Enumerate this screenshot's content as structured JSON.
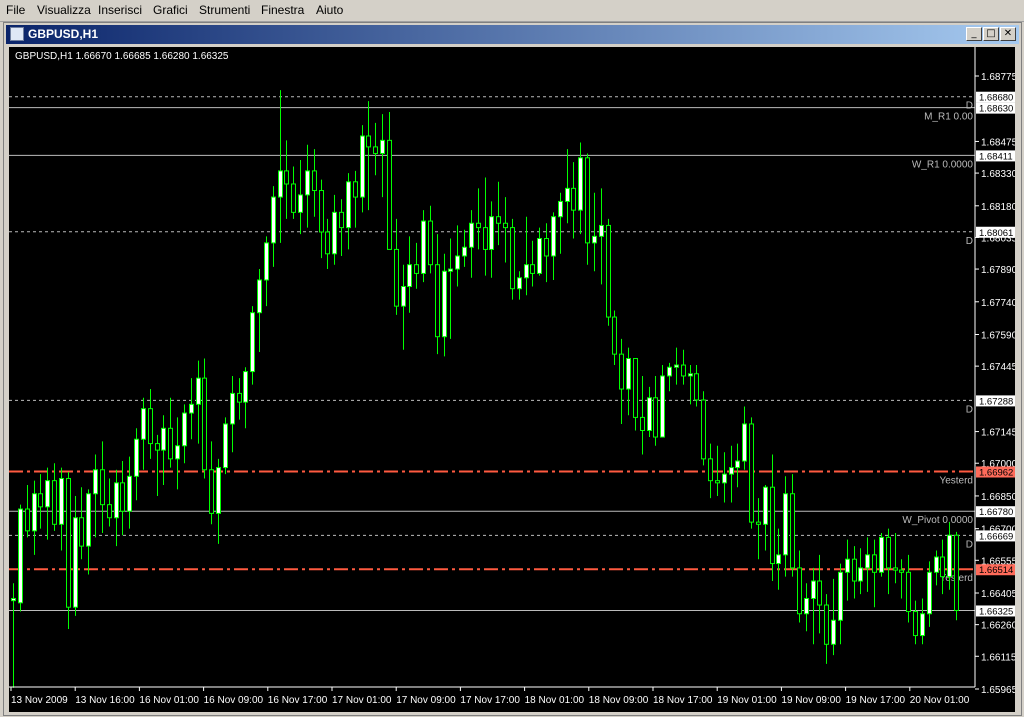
{
  "menu": [
    "File",
    "Visualizza",
    "Inserisci",
    "Grafici",
    "Strumenti",
    "Finestra",
    "Aiuto"
  ],
  "window": {
    "title": "GBPUSD,H1",
    "minimize_glyph": "_",
    "maximize_glyph": "□",
    "close_glyph": "✕"
  },
  "chart": {
    "info": "GBPUSD,H1  1.66670 1.66685 1.66280 1.66325",
    "symbol": "GBPUSD",
    "timeframe": "H1",
    "ohlc": {
      "open": 1.6667,
      "high": 1.66685,
      "low": 1.6628,
      "close": 1.66325
    },
    "colors": {
      "background": "#000000",
      "candle": "#00ff00",
      "bull_body": "#ffffff",
      "bear_body": "#000000",
      "level": "#bbbbbb",
      "yesterday": "#ff5a40"
    }
  },
  "chart_data": {
    "type": "candlestick",
    "title": "GBPUSD,H1",
    "price_ticks": [
      "1.68775",
      "1.68475",
      "1.68330",
      "1.68180",
      "1.68035",
      "1.67890",
      "1.67740",
      "1.67590",
      "1.67445",
      "1.67145",
      "1.67000",
      "1.66850",
      "1.66700",
      "1.66555",
      "1.66405",
      "1.66260",
      "1.66115",
      "1.65965"
    ],
    "ylim": [
      1.65965,
      1.68775
    ],
    "time_labels": [
      "13 Nov 2009",
      "13 Nov 16:00",
      "16 Nov 01:00",
      "16 Nov 09:00",
      "16 Nov 17:00",
      "17 Nov 01:00",
      "17 Nov 09:00",
      "17 Nov 17:00",
      "18 Nov 01:00",
      "18 Nov 09:00",
      "18 Nov 17:00",
      "19 Nov 01:00",
      "19 Nov 09:00",
      "19 Nov 17:00",
      "20 Nov 01:00"
    ],
    "levels": [
      {
        "price": 1.6868,
        "tag": "1.68680",
        "label": "D",
        "style": "dashed",
        "color": "#bbbbbb"
      },
      {
        "price": 1.6863,
        "tag": "1.68630",
        "label": "M_R1 0.00",
        "style": "solid",
        "color": "#bbbbbb"
      },
      {
        "price": 1.68411,
        "tag": "1.68411",
        "label": "W_R1 0.0000",
        "style": "solid",
        "color": "#bbbbbb"
      },
      {
        "price": 1.68061,
        "tag": "1.68061",
        "label": "D",
        "style": "dashed",
        "color": "#bbbbbb"
      },
      {
        "price": 1.67288,
        "tag": "1.67288",
        "label": "D",
        "style": "dashed",
        "color": "#bbbbbb"
      },
      {
        "price": 1.66962,
        "tag": "1.66962",
        "label": "Yesterd",
        "style": "dashdot",
        "color": "#ff5a40"
      },
      {
        "price": 1.6678,
        "tag": "1.66780",
        "label": "W_Pivot 0.0000",
        "style": "solid",
        "color": "#bbbbbb"
      },
      {
        "price": 1.66669,
        "tag": "1.66669",
        "label": "D",
        "style": "dashed",
        "color": "#bbbbbb"
      },
      {
        "price": 1.66514,
        "tag": "1.66514",
        "label": "Yesterd",
        "style": "dashdot",
        "color": "#ff5a40"
      },
      {
        "price": 1.66325,
        "tag": "1.66325",
        "label": "",
        "style": "solid",
        "color": "#bbbbbb"
      }
    ],
    "candles": [
      [
        1.6637,
        1.6645,
        1.6597,
        1.6638
      ],
      [
        1.6636,
        1.6681,
        1.6632,
        1.6679
      ],
      [
        1.6679,
        1.669,
        1.6666,
        1.6669
      ],
      [
        1.6669,
        1.6692,
        1.6658,
        1.6686
      ],
      [
        1.6686,
        1.6695,
        1.667,
        1.668
      ],
      [
        1.668,
        1.6698,
        1.6665,
        1.6692
      ],
      [
        1.6692,
        1.67,
        1.6669,
        1.6672
      ],
      [
        1.6672,
        1.6698,
        1.666,
        1.6693
      ],
      [
        1.6693,
        1.6696,
        1.6624,
        1.6634
      ],
      [
        1.6634,
        1.6685,
        1.663,
        1.6675
      ],
      [
        1.6675,
        1.6689,
        1.6656,
        1.6662
      ],
      [
        1.6662,
        1.6688,
        1.6649,
        1.6686
      ],
      [
        1.6686,
        1.6704,
        1.6666,
        1.6697
      ],
      [
        1.6697,
        1.671,
        1.6668,
        1.6681
      ],
      [
        1.6681,
        1.6693,
        1.6671,
        1.6675
      ],
      [
        1.6675,
        1.6697,
        1.6662,
        1.6691
      ],
      [
        1.6691,
        1.6701,
        1.6667,
        1.6678
      ],
      [
        1.6678,
        1.6703,
        1.667,
        1.6694
      ],
      [
        1.6694,
        1.6716,
        1.6683,
        1.6711
      ],
      [
        1.6711,
        1.673,
        1.6697,
        1.6725
      ],
      [
        1.6725,
        1.6734,
        1.6702,
        1.6709
      ],
      [
        1.6709,
        1.6713,
        1.6685,
        1.6706
      ],
      [
        1.6706,
        1.6722,
        1.669,
        1.6716
      ],
      [
        1.6716,
        1.673,
        1.6698,
        1.6702
      ],
      [
        1.6702,
        1.6721,
        1.6688,
        1.6708
      ],
      [
        1.6708,
        1.6727,
        1.67,
        1.6723
      ],
      [
        1.6723,
        1.6739,
        1.6711,
        1.6727
      ],
      [
        1.6727,
        1.6747,
        1.6709,
        1.6739
      ],
      [
        1.6739,
        1.6748,
        1.6693,
        1.6697
      ],
      [
        1.6697,
        1.671,
        1.6672,
        1.6677
      ],
      [
        1.6677,
        1.6702,
        1.6663,
        1.6698
      ],
      [
        1.6698,
        1.6721,
        1.6695,
        1.6718
      ],
      [
        1.6718,
        1.674,
        1.6705,
        1.6732
      ],
      [
        1.6732,
        1.6739,
        1.672,
        1.6728
      ],
      [
        1.6728,
        1.6744,
        1.6716,
        1.6742
      ],
      [
        1.6742,
        1.6772,
        1.6736,
        1.6769
      ],
      [
        1.6769,
        1.6789,
        1.6751,
        1.6784
      ],
      [
        1.6784,
        1.6804,
        1.6772,
        1.6801
      ],
      [
        1.6801,
        1.6827,
        1.679,
        1.6822
      ],
      [
        1.6822,
        1.6871,
        1.6801,
        1.6834
      ],
      [
        1.6834,
        1.6848,
        1.6812,
        1.6828
      ],
      [
        1.6828,
        1.6836,
        1.6812,
        1.6815
      ],
      [
        1.6815,
        1.6839,
        1.6805,
        1.6823
      ],
      [
        1.6823,
        1.6846,
        1.6808,
        1.6834
      ],
      [
        1.6834,
        1.6844,
        1.6813,
        1.6825
      ],
      [
        1.6825,
        1.683,
        1.6794,
        1.6806
      ],
      [
        1.6806,
        1.6812,
        1.6789,
        1.6796
      ],
      [
        1.6796,
        1.6823,
        1.6791,
        1.6815
      ],
      [
        1.6815,
        1.6821,
        1.6795,
        1.6808
      ],
      [
        1.6808,
        1.6833,
        1.6798,
        1.6829
      ],
      [
        1.6829,
        1.6834,
        1.6808,
        1.6822
      ],
      [
        1.6822,
        1.6855,
        1.6815,
        1.685
      ],
      [
        1.685,
        1.6866,
        1.6816,
        1.6845
      ],
      [
        1.6845,
        1.6856,
        1.6832,
        1.6842
      ],
      [
        1.6842,
        1.686,
        1.6822,
        1.6848
      ],
      [
        1.6848,
        1.6861,
        1.6799,
        1.6798
      ],
      [
        1.6798,
        1.6812,
        1.6768,
        1.6772
      ],
      [
        1.6772,
        1.6791,
        1.6752,
        1.6781
      ],
      [
        1.6781,
        1.6804,
        1.6769,
        1.6791
      ],
      [
        1.6791,
        1.6801,
        1.678,
        1.6787
      ],
      [
        1.6787,
        1.6816,
        1.6783,
        1.6811
      ],
      [
        1.6811,
        1.6818,
        1.6787,
        1.6791
      ],
      [
        1.6791,
        1.6805,
        1.675,
        1.6758
      ],
      [
        1.6758,
        1.6796,
        1.6749,
        1.6788
      ],
      [
        1.6788,
        1.6803,
        1.6757,
        1.6789
      ],
      [
        1.6789,
        1.6809,
        1.6781,
        1.6795
      ],
      [
        1.6795,
        1.6807,
        1.679,
        1.6799
      ],
      [
        1.6799,
        1.6816,
        1.6785,
        1.681
      ],
      [
        1.681,
        1.6826,
        1.6798,
        1.6808
      ],
      [
        1.6808,
        1.6831,
        1.6786,
        1.6798
      ],
      [
        1.6798,
        1.682,
        1.6785,
        1.6813
      ],
      [
        1.6813,
        1.6829,
        1.68,
        1.681
      ],
      [
        1.681,
        1.6822,
        1.6792,
        1.6808
      ],
      [
        1.6808,
        1.6812,
        1.6775,
        1.678
      ],
      [
        1.678,
        1.6788,
        1.6775,
        1.6785
      ],
      [
        1.6785,
        1.6813,
        1.6777,
        1.6791
      ],
      [
        1.6791,
        1.6802,
        1.6781,
        1.6787
      ],
      [
        1.6787,
        1.6808,
        1.6786,
        1.6803
      ],
      [
        1.6803,
        1.681,
        1.6783,
        1.6795
      ],
      [
        1.6795,
        1.6815,
        1.6784,
        1.6813
      ],
      [
        1.6813,
        1.6824,
        1.6796,
        1.682
      ],
      [
        1.682,
        1.6844,
        1.681,
        1.6826
      ],
      [
        1.6826,
        1.6838,
        1.6803,
        1.6816
      ],
      [
        1.6816,
        1.6847,
        1.6805,
        1.684
      ],
      [
        1.684,
        1.6842,
        1.6791,
        1.6801
      ],
      [
        1.6801,
        1.6824,
        1.6788,
        1.6804
      ],
      [
        1.6804,
        1.6826,
        1.6782,
        1.6809
      ],
      [
        1.6809,
        1.6812,
        1.6763,
        1.6767
      ],
      [
        1.6767,
        1.677,
        1.6745,
        1.675
      ],
      [
        1.675,
        1.6757,
        1.6718,
        1.6734
      ],
      [
        1.6734,
        1.6753,
        1.6722,
        1.6748
      ],
      [
        1.6748,
        1.6748,
        1.6715,
        1.6721
      ],
      [
        1.6721,
        1.674,
        1.6704,
        1.6715
      ],
      [
        1.6715,
        1.6735,
        1.6712,
        1.673
      ],
      [
        1.673,
        1.674,
        1.6708,
        1.6712
      ],
      [
        1.6712,
        1.6745,
        1.6712,
        1.674
      ],
      [
        1.674,
        1.6746,
        1.6733,
        1.6744
      ],
      [
        1.6744,
        1.6753,
        1.6736,
        1.6745
      ],
      [
        1.6745,
        1.6752,
        1.6736,
        1.674
      ],
      [
        1.674,
        1.6745,
        1.6727,
        1.6741
      ],
      [
        1.6741,
        1.6745,
        1.6726,
        1.6729
      ],
      [
        1.6729,
        1.6733,
        1.6699,
        1.6702
      ],
      [
        1.6702,
        1.6709,
        1.6684,
        1.6692
      ],
      [
        1.6692,
        1.6708,
        1.6685,
        1.6691
      ],
      [
        1.6691,
        1.6705,
        1.6682,
        1.6695
      ],
      [
        1.6695,
        1.6708,
        1.6682,
        1.6698
      ],
      [
        1.6698,
        1.6709,
        1.6689,
        1.6701
      ],
      [
        1.6701,
        1.6726,
        1.6697,
        1.6718
      ],
      [
        1.6718,
        1.6721,
        1.667,
        1.6673
      ],
      [
        1.6673,
        1.6684,
        1.6656,
        1.6672
      ],
      [
        1.6672,
        1.669,
        1.666,
        1.6689
      ],
      [
        1.6689,
        1.6704,
        1.6646,
        1.6654
      ],
      [
        1.6654,
        1.667,
        1.6642,
        1.6658
      ],
      [
        1.6658,
        1.6694,
        1.6648,
        1.6686
      ],
      [
        1.6686,
        1.6695,
        1.6648,
        1.6652
      ],
      [
        1.6652,
        1.666,
        1.6627,
        1.6631
      ],
      [
        1.6631,
        1.6645,
        1.6623,
        1.6638
      ],
      [
        1.6638,
        1.6652,
        1.6617,
        1.6646
      ],
      [
        1.6646,
        1.6658,
        1.6622,
        1.6635
      ],
      [
        1.6635,
        1.664,
        1.6608,
        1.6617
      ],
      [
        1.6617,
        1.6647,
        1.6612,
        1.6628
      ],
      [
        1.6628,
        1.6654,
        1.6617,
        1.665
      ],
      [
        1.665,
        1.6665,
        1.6637,
        1.6656
      ],
      [
        1.6656,
        1.6662,
        1.6638,
        1.6646
      ],
      [
        1.6646,
        1.6661,
        1.664,
        1.6652
      ],
      [
        1.6652,
        1.6666,
        1.6641,
        1.6658
      ],
      [
        1.6658,
        1.6665,
        1.6634,
        1.665
      ],
      [
        1.665,
        1.6668,
        1.6648,
        1.6666
      ],
      [
        1.6666,
        1.667,
        1.664,
        1.6652
      ],
      [
        1.6652,
        1.6668,
        1.6645,
        1.6651
      ],
      [
        1.6651,
        1.6656,
        1.6638,
        1.665
      ],
      [
        1.665,
        1.6658,
        1.6627,
        1.6632
      ],
      [
        1.6632,
        1.6637,
        1.6617,
        1.6621
      ],
      [
        1.6621,
        1.6638,
        1.6617,
        1.6631
      ],
      [
        1.6631,
        1.6655,
        1.6625,
        1.665
      ],
      [
        1.665,
        1.666,
        1.6644,
        1.6657
      ],
      [
        1.6657,
        1.6665,
        1.664,
        1.6648
      ],
      [
        1.6648,
        1.6673,
        1.6642,
        1.6667
      ],
      [
        1.6667,
        1.66685,
        1.6628,
        1.66325
      ]
    ]
  }
}
